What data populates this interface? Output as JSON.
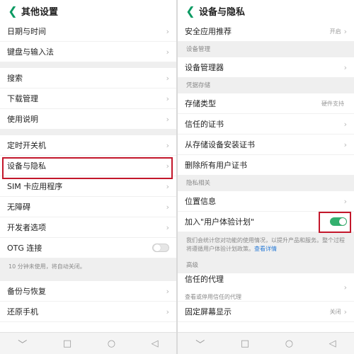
{
  "left": {
    "title": "其他设置",
    "groups": [
      [
        {
          "label": "日期与时间"
        },
        {
          "label": "键盘与输入法"
        }
      ],
      [
        {
          "label": "搜索"
        },
        {
          "label": "下载管理"
        },
        {
          "label": "使用说明"
        }
      ],
      [
        {
          "label": "定时开关机"
        },
        {
          "label": "设备与隐私"
        },
        {
          "label": "SIM 卡应用程序"
        },
        {
          "label": "无障碍"
        },
        {
          "label": "开发者选项"
        },
        {
          "label": "OTG 连接"
        }
      ]
    ],
    "otg_note": "10 分钟未使用，将自动关闭。",
    "bottom": [
      {
        "label": "备份与恢复"
      },
      {
        "label": "还原手机"
      }
    ]
  },
  "right": {
    "title": "设备与隐私",
    "app_rec": {
      "label": "安全应用推荐",
      "value": "开启"
    },
    "sec_device": "设备管理",
    "device_manager": "设备管理器",
    "sec_cred": "凭据存储",
    "storage_type": {
      "label": "存储类型",
      "value": "硬件支持"
    },
    "trusted_cert": "信任的证书",
    "install_cert": "从存储设备安装证书",
    "clear_cert": "删除所有用户证书",
    "sec_privacy": "隐私相关",
    "location": "位置信息",
    "ux_plan": "加入\"用户体验计划\"",
    "ux_note": "我们会统计您对功能的使用情况，以提升产品和服务。整个过程将遵循用户体验计划政策。",
    "ux_link": "查看详情",
    "sec_advanced": "高级",
    "trust_agent": {
      "label": "信任的代理",
      "sub": "查看或停用信任的代理"
    },
    "screen_pin": {
      "label": "固定屏幕显示",
      "value": "关闭"
    }
  },
  "nav": {
    "down": "﹀",
    "home": "□",
    "circle": "○",
    "back": "◁"
  }
}
